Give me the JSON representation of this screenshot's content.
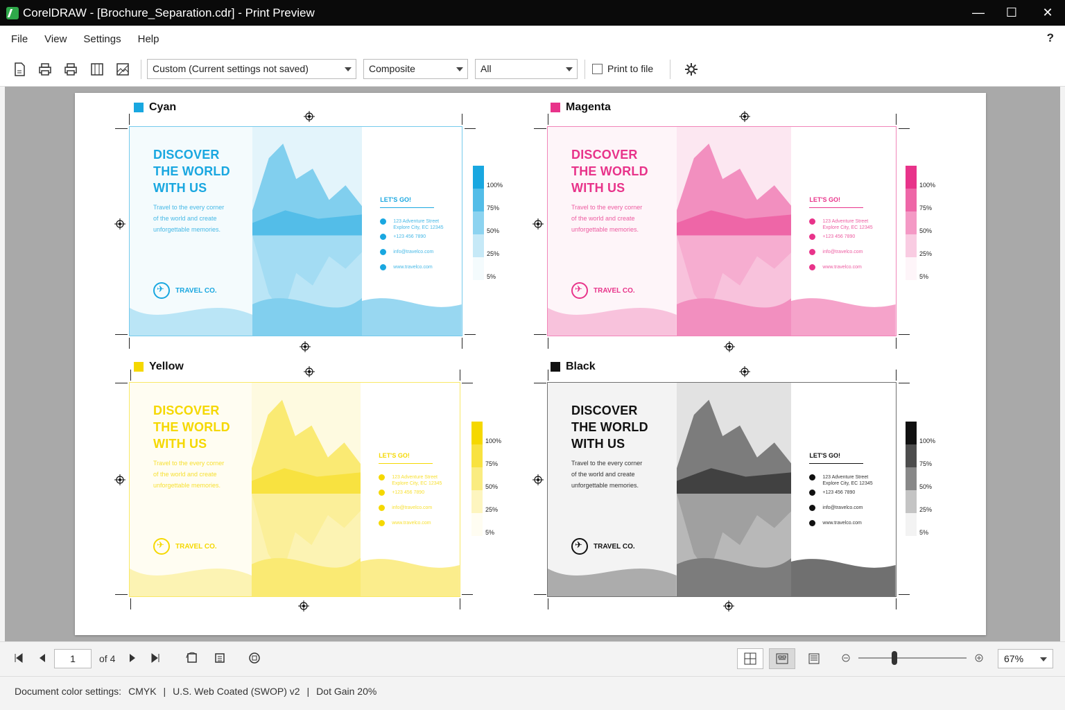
{
  "window": {
    "title": "CorelDRAW - [Brochure_Separation.cdr] - Print Preview",
    "minimize": "—",
    "maximize": "☐",
    "close": "✕"
  },
  "menu": {
    "items": [
      "File",
      "View",
      "Settings",
      "Help"
    ],
    "help": "?"
  },
  "toolbar": {
    "icons": [
      "new-page-icon",
      "print-icon",
      "print-quick-icon",
      "page-layout-icon",
      "imposition-icon"
    ],
    "preset": "Custom (Current settings not saved)",
    "mode": "Composite",
    "range": "All",
    "print_to_file": "Print to file",
    "settings_icon": "gear-icon"
  },
  "colors": {
    "cyan": "#19a7e0",
    "magenta": "#e8338a",
    "yellow": "#f5d800",
    "black": "#111111"
  },
  "plates": [
    {
      "name": "Cyan",
      "color": "#19a7e0"
    },
    {
      "name": "Magenta",
      "color": "#e8338a"
    },
    {
      "name": "Yellow",
      "color": "#f5d800"
    },
    {
      "name": "Black",
      "color": "#111111"
    }
  ],
  "brochure": {
    "headline": [
      "DISCOVER",
      "THE WORLD",
      "WITH US"
    ],
    "subtext": [
      "Travel to the every corner",
      "of the world and create",
      "unforgettable memories."
    ],
    "logo": "TRAVEL CO.",
    "cta": "LET'S GO!",
    "contacts": [
      {
        "icon": "location-icon",
        "lines": [
          "123 Adventure Street",
          "Explore City, EC 12345"
        ]
      },
      {
        "icon": "phone-icon",
        "lines": [
          "+123 456 7890"
        ]
      },
      {
        "icon": "email-icon",
        "lines": [
          "info@travelco.com"
        ]
      },
      {
        "icon": "globe-icon",
        "lines": [
          "www.travelco.com"
        ]
      }
    ]
  },
  "scale": {
    "levels": [
      1.0,
      0.75,
      0.5,
      0.25,
      0.05
    ],
    "labels": [
      "100%",
      "75%",
      "50%",
      "25%",
      "5%"
    ]
  },
  "navigation": {
    "page": "1",
    "of": "of 4"
  },
  "zoom": {
    "value": "67%",
    "level": 0.33
  },
  "doc_settings": {
    "label": "Document color settings:",
    "model": "CMYK",
    "profile": "U.S. Web Coated (SWOP) v2",
    "dot_gain": "Dot Gain 20%"
  }
}
